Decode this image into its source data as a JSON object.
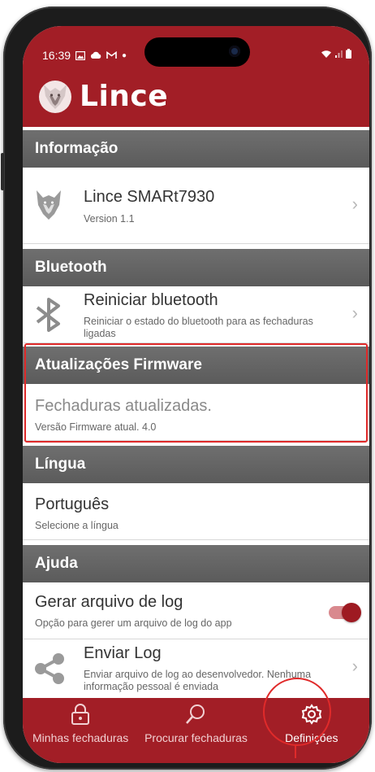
{
  "status_bar": {
    "time": "16:39",
    "notification_icons": [
      "image-icon",
      "cloud-icon",
      "gmail-icon",
      "dot-icon"
    ],
    "right_icons": [
      "wifi-icon",
      "signal-icon",
      "battery-icon"
    ]
  },
  "header": {
    "app_name": "Lince"
  },
  "sections": {
    "info": {
      "title": "Informação",
      "device_name": "Lince SMARt7930",
      "version": "Version 1.1"
    },
    "bluetooth": {
      "title": "Bluetooth",
      "restart_title": "Reiniciar bluetooth",
      "restart_sub": "Reiniciar o estado do bluetooth para as fechaduras ligadas"
    },
    "firmware": {
      "title": "Atualizações Firmware",
      "status": "Fechaduras atualizadas.",
      "version": "Versão Firmware atual. 4.0"
    },
    "language": {
      "title": "Língua",
      "value": "Português",
      "sub": "Selecione a língua"
    },
    "help": {
      "title": "Ajuda",
      "log_title": "Gerar arquivo de log",
      "log_sub": "Opção para gerer um arquivo de log do app",
      "log_toggle_on": true,
      "send_title": "Enviar Log",
      "send_sub": "Enviar arquivo de log ao desenvolvedor. Nenhuma informação pessoal é enviada"
    }
  },
  "nav": {
    "items": [
      {
        "label": "Minhas fechaduras",
        "icon": "padlock-icon"
      },
      {
        "label": "Procurar fechaduras",
        "icon": "search-icon"
      },
      {
        "label": "Definições",
        "icon": "gear-icon",
        "active": true
      }
    ]
  },
  "colors": {
    "brand": "#a21e26",
    "section_header": "#636363",
    "highlight": "#e02a2a"
  }
}
